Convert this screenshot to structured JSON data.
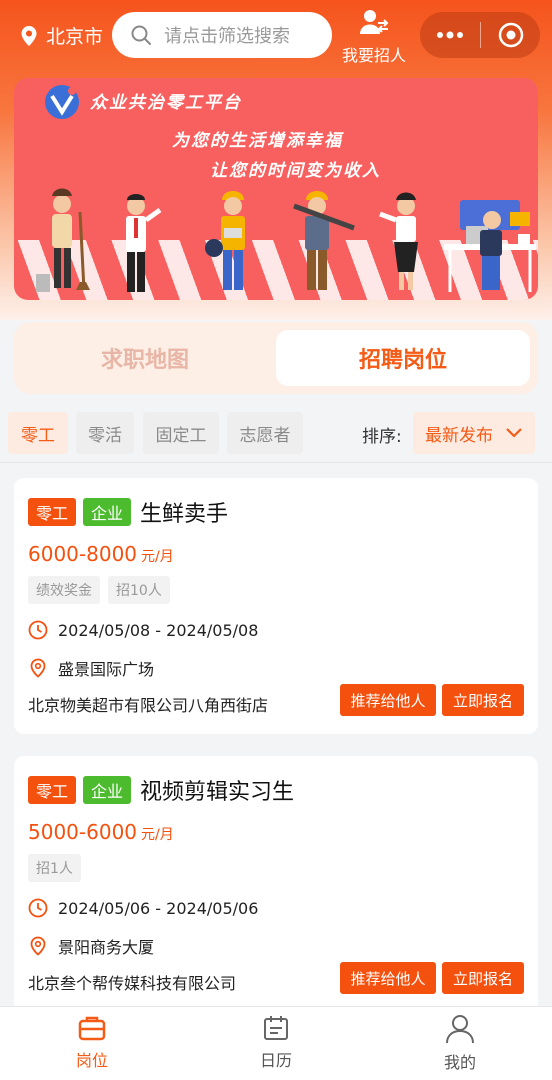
{
  "header": {
    "city": "北京市",
    "search_placeholder": "请点击筛选搜索",
    "recruit_label": "我要招人"
  },
  "banner": {
    "brand": "众业共治零工平台",
    "slogan_line1": "为您的生活增添幸福",
    "slogan_line2": "让您的时间变为收入"
  },
  "switch": {
    "left_label": "求职地图",
    "right_label": "招聘岗位"
  },
  "filters": {
    "chips": [
      "零工",
      "零活",
      "固定工",
      "志愿者"
    ],
    "sort_label": "排序:",
    "sort_value": "最新发布"
  },
  "jobs": [
    {
      "type_tag": "零工",
      "org_tag": "企业",
      "title": "生鲜卖手",
      "salary": "6000-8000",
      "salary_unit": "元/月",
      "perks": [
        "绩效奖金",
        "招10人"
      ],
      "date_range": "2024/05/08 - 2024/05/08",
      "location": "盛景国际广场",
      "company": "北京物美超市有限公司八角西街店",
      "recommend_label": "推荐给他人",
      "apply_label": "立即报名"
    },
    {
      "type_tag": "零工",
      "org_tag": "企业",
      "title": "视频剪辑实习生",
      "salary": "5000-6000",
      "salary_unit": "元/月",
      "perks": [
        "招1人"
      ],
      "date_range": "2024/05/06 - 2024/05/06",
      "location": "景阳商务大厦",
      "company": "北京叁个帮传媒科技有限公司",
      "recommend_label": "推荐给他人",
      "apply_label": "立即报名"
    }
  ],
  "nav": {
    "items": [
      {
        "label": "岗位",
        "icon": "briefcase-icon"
      },
      {
        "label": "日历",
        "icon": "calendar-icon"
      },
      {
        "label": "我的",
        "icon": "user-icon"
      }
    ]
  },
  "colors": {
    "accent": "#f4510f",
    "green_tag": "#4cbb2e",
    "banner_bg": "#f85f5f"
  }
}
